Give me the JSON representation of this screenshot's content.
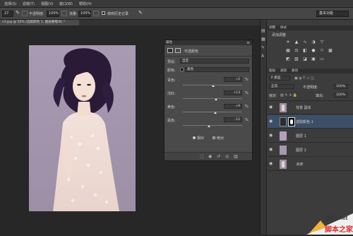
{
  "menubar": {
    "items": [
      "选择(S)",
      "滤镜(T)",
      "视图(V)",
      "窗口(W)",
      "帮助(H)"
    ]
  },
  "options": {
    "size": "27",
    "opacity_label": "不透明度:",
    "opacity": "100%",
    "flow_label": "流量:",
    "flow": "100%",
    "history_label": "抹到历史记录",
    "workspace": "基本功能"
  },
  "document": {
    "tab": "c3.jpg @ 50% (选取颜色 1, 图层蒙版/8) *"
  },
  "properties": {
    "panel_title": "属性",
    "adjustment_name": "可选颜色",
    "preset_label": "预设:",
    "preset_value": "自定",
    "colors_label": "颜色:",
    "colors_value": "黑色",
    "sliders": [
      {
        "label": "青色:",
        "value": "+2",
        "pct": 0.51
      },
      {
        "label": "洋红:",
        "value": "+13",
        "pct": 0.565
      },
      {
        "label": "黄色:",
        "value": "+9",
        "pct": 0.545
      },
      {
        "label": "黑色:",
        "value": "-12",
        "pct": 0.44
      }
    ],
    "unit": "%",
    "method_relative": "相对",
    "method_absolute": "绝对"
  },
  "adjustments": {
    "tab_adjust": "调整",
    "tab_styles": "样式",
    "title": "添加调整"
  },
  "layers": {
    "tab_layers": "图层",
    "tab_channels": "通道",
    "tab_paths": "路径",
    "kind_label": "P 类型",
    "mode": "正常",
    "opacity_label": "不透明度:",
    "opacity": "100%",
    "lock_label": "锁定:",
    "fill_label": "填充:",
    "fill": "100%",
    "items": [
      {
        "name": "背景 副本"
      },
      {
        "name": "选取颜色 1"
      },
      {
        "name": "图层 1"
      },
      {
        "name": "图层 2"
      },
      {
        "name": "背景"
      }
    ]
  },
  "watermark": {
    "site": "jb51.net",
    "text": "脚本之家"
  },
  "colors": {
    "accent_selected": "#3d4f66",
    "canvas_bg": "#a899b0",
    "panel_bg": "#4a4a4a",
    "watermark_red": "#d9332f"
  }
}
